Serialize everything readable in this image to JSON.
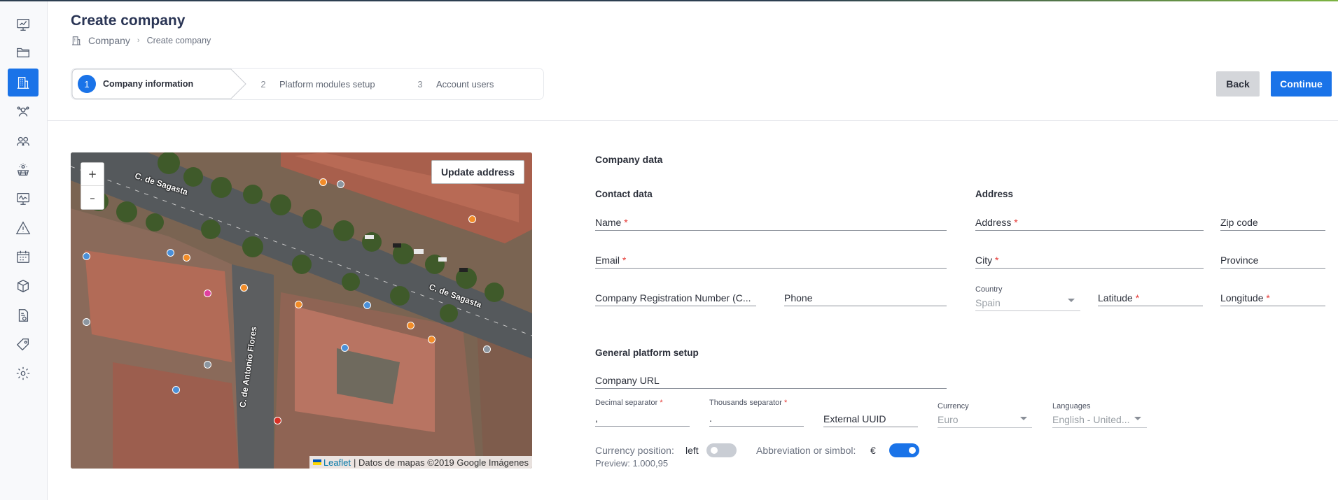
{
  "header": {
    "title": "Create company",
    "breadcrumb": {
      "root": "Company",
      "current": "Create company"
    }
  },
  "stepper": {
    "steps": [
      {
        "number": "1",
        "label": "Company information"
      },
      {
        "number": "2",
        "label": "Platform modules setup"
      },
      {
        "number": "3",
        "label": "Account users"
      }
    ]
  },
  "actions": {
    "back_label": "Back",
    "continue_label": "Continue"
  },
  "sidebar": {
    "items": [
      {
        "icon": "dashboard-icon"
      },
      {
        "icon": "folder-icon"
      },
      {
        "icon": "building-icon"
      },
      {
        "icon": "users-network-icon"
      },
      {
        "icon": "groups-icon"
      },
      {
        "icon": "solar-panel-icon"
      },
      {
        "icon": "monitor-chart-icon"
      },
      {
        "icon": "warning-icon"
      },
      {
        "icon": "calendar-icon"
      },
      {
        "icon": "box-icon"
      },
      {
        "icon": "invoice-icon"
      },
      {
        "icon": "tag-icon"
      },
      {
        "icon": "gear-icon"
      }
    ],
    "active_color": "#1a73e8"
  },
  "map": {
    "zoom_in": "+",
    "zoom_out": "–",
    "update_address_label": "Update address",
    "attribution_leaflet": "Leaflet",
    "attribution_text": "| Datos de mapas ©2019 Google Imágenes",
    "streets": [
      "C. de Sagasta",
      "C. de Sagasta",
      "C. de Antonio Flores"
    ]
  },
  "form": {
    "company_data_title": "Company data",
    "contact_title": "Contact data",
    "address_title": "Address",
    "general_title": "General platform setup",
    "name_label": "Name",
    "email_label": "Email",
    "crn_label": "Company Registration Number (C...",
    "phone_label": "Phone",
    "address_label": "Address",
    "zip_label": "Zip code",
    "city_label": "City",
    "province_label": "Province",
    "country_label": "Country",
    "country_value": "Spain",
    "latitude_label": "Latitude",
    "longitude_label": "Longitude",
    "required_mark": "*",
    "company_url_label": "Company URL",
    "decimal_label": "Decimal separator",
    "decimal_value": ",",
    "thousands_label": "Thousands separator",
    "thousands_value": ".",
    "external_uuid_label": "External UUID",
    "currency_label": "Currency",
    "currency_value": "Euro",
    "languages_label": "Languages",
    "languages_value": "English - United...",
    "currency_position_label": "Currency position:",
    "currency_position_value": "left",
    "abbreviation_label": "Abbreviation or simbol:",
    "abbreviation_value": "€",
    "preview": "Preview: 1.000,95"
  }
}
